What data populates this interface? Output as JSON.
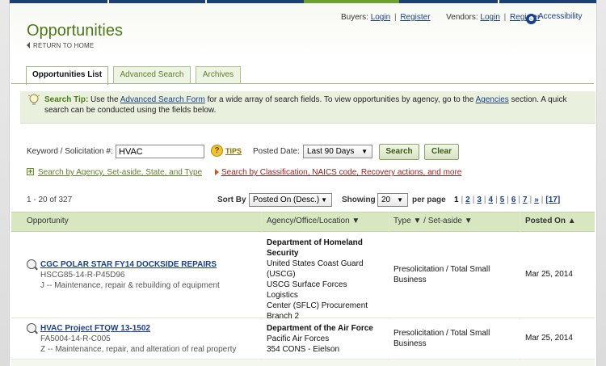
{
  "user_links": {
    "buyers_label": "Buyers:",
    "vendors_label": "Vendors:",
    "login": "Login",
    "register": "Register",
    "separator": "|",
    "accessibility": "Accessibility"
  },
  "page": {
    "title": "Opportunities",
    "return_home": "RETURN TO HOME"
  },
  "tabs": [
    {
      "label": "Opportunities List",
      "active": true
    },
    {
      "label": "Advanced Search",
      "active": false
    },
    {
      "label": "Archives",
      "active": false
    }
  ],
  "search_tip": {
    "label": "Search Tip:",
    "text_1": " Use the ",
    "link_1": "Advanced Search Form",
    "text_2": " for a wide array of search fields. To view opportunities by agency, go to the ",
    "link_2": "Agencies",
    "text_3": " section. A quick search can be conducted using the fields below."
  },
  "search_form": {
    "keyword_label": "Keyword / Solicitation #:",
    "keyword_value": "HVAC",
    "tips_label": "TIPS",
    "posted_date_label": "Posted Date:",
    "posted_date_value": "Last 90 Days",
    "search_button": "Search",
    "clear_button": "Clear",
    "agency_link": "Search by Agency, Set-aside, State, and Type",
    "classification_link": "Search by Classification, NAICS code, Recovery actions, and more"
  },
  "results": {
    "count": "1 - 20 of 327",
    "sort_by_label": "Sort By",
    "sort_by_value": "Posted On (Desc.)",
    "showing_label": "Showing",
    "showing_value": "20",
    "per_page_label": "per page",
    "pages": [
      "1",
      "2",
      "3",
      "4",
      "5",
      "6",
      "7",
      "»",
      "[17]"
    ]
  },
  "table": {
    "headers": {
      "opportunity": "Opportunity",
      "agency": "Agency/Office/Location ▼",
      "type": "Type  ▼  /  Set-aside  ▼",
      "posted_on": "Posted On ▲"
    },
    "rows": [
      {
        "title": "CGC POLAR STAR FY14 DOCKSIDE REPAIRS",
        "solicitation": "HSCG85-14-R-P45D96",
        "classification": "J -- Maintenance, repair & rebuilding of equipment",
        "agency_name": "Department of Homeland Security",
        "agency_lines": [
          "United States Coast Guard",
          "(USCG)",
          "USCG Surface Forces Logistics",
          "Center (SFLC) Procurement",
          "Branch 2"
        ],
        "type": "Presolicitation / Total Small Business",
        "posted_on": "Mar 25, 2014"
      },
      {
        "title": "HVAC Project FTQW 13-1502",
        "solicitation": "FA5004-14-R-C005",
        "classification": "Z -- Maintenance, repair, and alteration of real property",
        "agency_name": "Department of the Air Force",
        "agency_lines": [
          "Pacific Air Forces",
          "354 CONS - Eielson"
        ],
        "type": "Presolicitation / Total Small Business",
        "posted_on": "Mar 25, 2014"
      }
    ]
  }
}
